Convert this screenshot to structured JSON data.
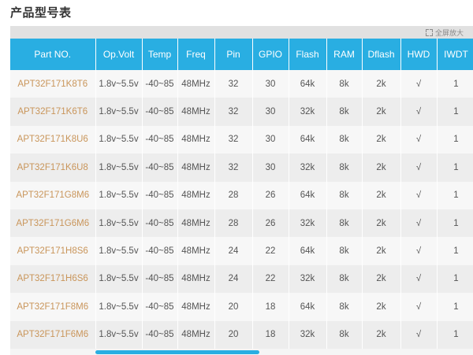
{
  "page": {
    "title": "产品型号表"
  },
  "toolbar": {
    "fullscreen_label": "全屏放大"
  },
  "table": {
    "headers": [
      "Part NO.",
      "Op.Volt",
      "Temp",
      "Freq",
      "Pin",
      "GPIO",
      "Flash",
      "RAM",
      "Dflash",
      "HWD",
      "IWDT"
    ],
    "rows": [
      [
        "APT32F171K8T6",
        "1.8v~5.5v",
        "-40~85",
        "48MHz",
        "32",
        "30",
        "64k",
        "8k",
        "2k",
        "√",
        "1"
      ],
      [
        "APT32F171K6T6",
        "1.8v~5.5v",
        "-40~85",
        "48MHz",
        "32",
        "30",
        "32k",
        "8k",
        "2k",
        "√",
        "1"
      ],
      [
        "APT32F171K8U6",
        "1.8v~5.5v",
        "-40~85",
        "48MHz",
        "32",
        "30",
        "64k",
        "8k",
        "2k",
        "√",
        "1"
      ],
      [
        "APT32F171K6U8",
        "1.8v~5.5v",
        "-40~85",
        "48MHz",
        "32",
        "30",
        "32k",
        "8k",
        "2k",
        "√",
        "1"
      ],
      [
        "APT32F171G8M6",
        "1.8v~5.5v",
        "-40~85",
        "48MHz",
        "28",
        "26",
        "64k",
        "8k",
        "2k",
        "√",
        "1"
      ],
      [
        "APT32F171G6M6",
        "1.8v~5.5v",
        "-40~85",
        "48MHz",
        "28",
        "26",
        "32k",
        "8k",
        "2k",
        "√",
        "1"
      ],
      [
        "APT32F171H8S6",
        "1.8v~5.5v",
        "-40~85",
        "48MHz",
        "24",
        "22",
        "64k",
        "8k",
        "2k",
        "√",
        "1"
      ],
      [
        "APT32F171H6S6",
        "1.8v~5.5v",
        "-40~85",
        "48MHz",
        "24",
        "22",
        "32k",
        "8k",
        "2k",
        "√",
        "1"
      ],
      [
        "APT32F171F8M6",
        "1.8v~5.5v",
        "-40~85",
        "48MHz",
        "20",
        "18",
        "64k",
        "8k",
        "2k",
        "√",
        "1"
      ],
      [
        "APT32F171F6M6",
        "1.8v~5.5v",
        "-40~85",
        "48MHz",
        "20",
        "18",
        "32k",
        "8k",
        "2k",
        "√",
        "1"
      ]
    ]
  },
  "colors": {
    "header_bg": "#29aee2",
    "part_number_text": "#c9955a",
    "row_odd": "#f7f7f7",
    "row_even": "#ededed"
  },
  "icons": {
    "fullscreen": "expand-icon"
  }
}
